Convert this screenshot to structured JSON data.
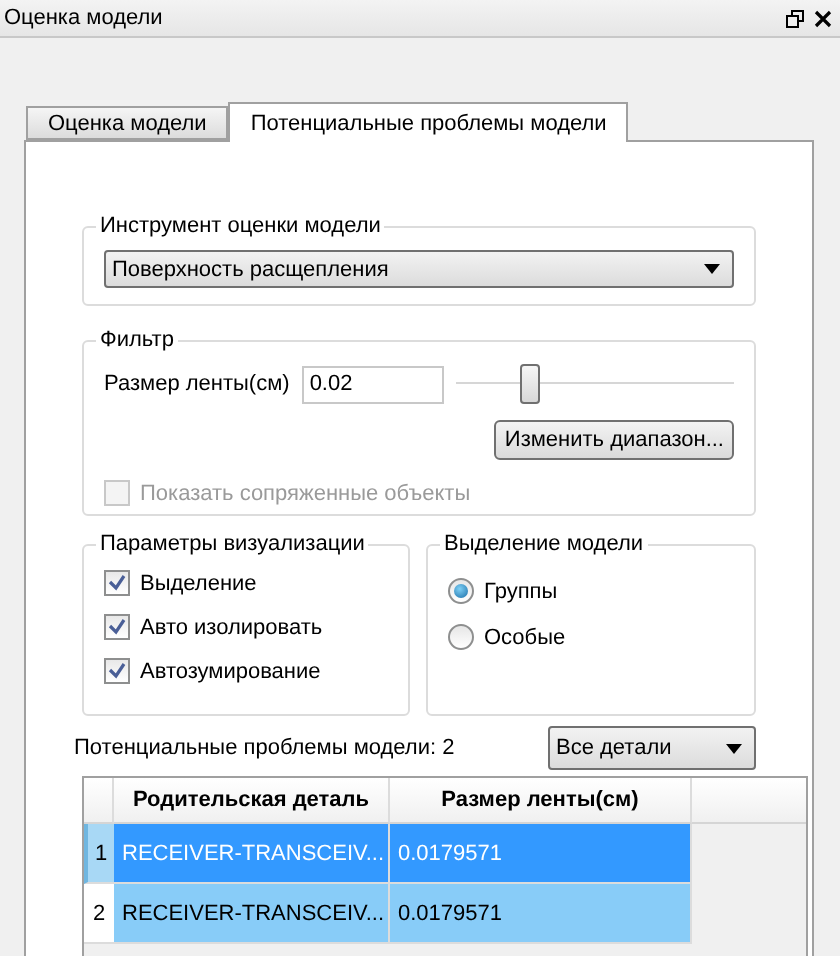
{
  "window": {
    "title": "Оценка модели"
  },
  "tabs": [
    {
      "label": "Оценка модели",
      "selected": false
    },
    {
      "label": "Потенциальные проблемы модели",
      "selected": true
    }
  ],
  "tool_group": {
    "title": "Инструмент оценки модели",
    "dropdown": "Поверхность расщепления"
  },
  "filter_group": {
    "title": "Фильтр",
    "size_label": "Размер ленты(см)",
    "size_value": "0.02",
    "slider": {
      "level": 0.27
    },
    "range_button": "Изменить диапазон...",
    "show_mates": {
      "label": "Показать сопряженные объекты",
      "checked": false,
      "disabled": true
    }
  },
  "visualization_group": {
    "title": "Параметры визуализации",
    "options": [
      {
        "label": "Выделение",
        "checked": true
      },
      {
        "label": "Авто изолировать",
        "checked": true
      },
      {
        "label": "Автозумирование",
        "checked": true
      }
    ]
  },
  "selection_group": {
    "title": "Выделение модели",
    "options": [
      {
        "label": "Группы",
        "selected": true
      },
      {
        "label": "Особые",
        "selected": false
      }
    ]
  },
  "issues_count": "Потенциальные проблемы модели: 2",
  "parts_filter": "Все детали",
  "table": {
    "columns": [
      "Родительская деталь",
      "Размер ленты(см)"
    ],
    "rows": [
      {
        "number": "1",
        "cells": [
          "RECEIVER-TRANSCEIV...",
          "0.0179571"
        ],
        "selected": true
      },
      {
        "number": "2",
        "cells": [
          "RECEIVER-TRANSCEIV...",
          "0.0179571"
        ],
        "selected": false
      }
    ]
  }
}
